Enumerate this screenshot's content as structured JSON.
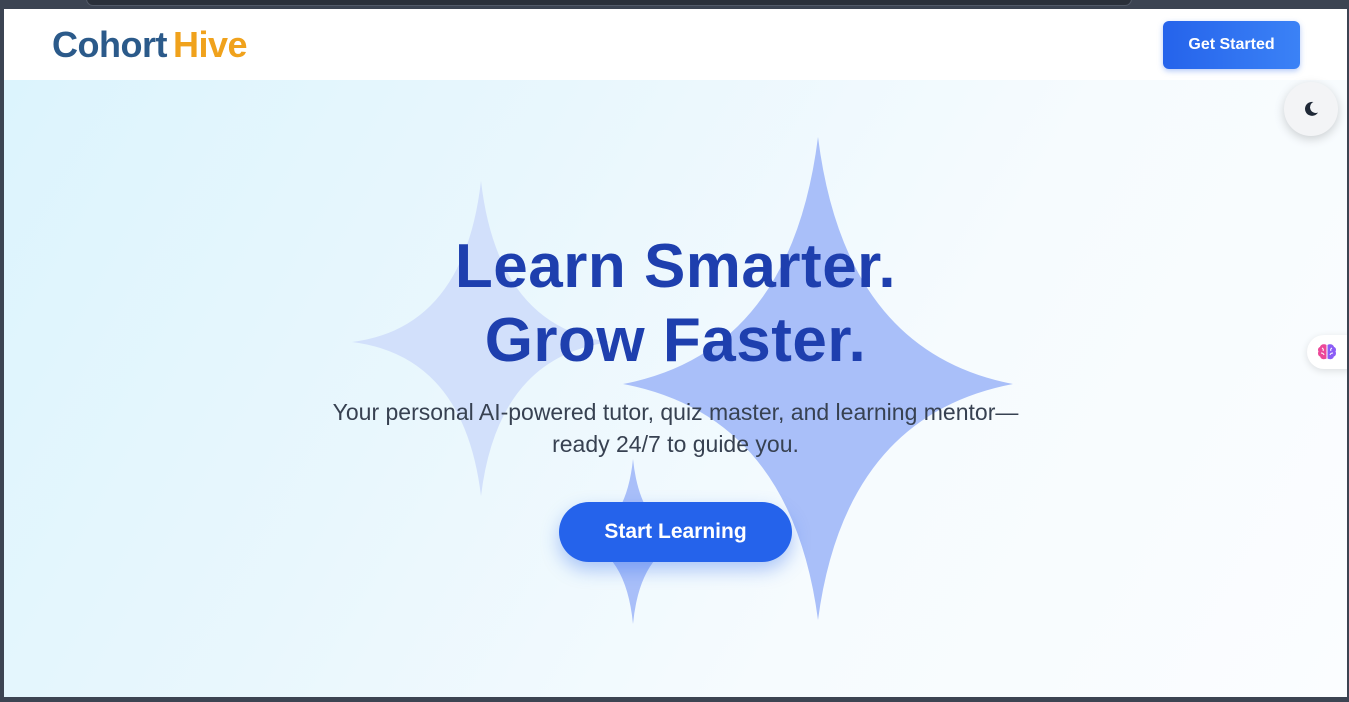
{
  "header": {
    "logo_part1": "Cohort",
    "logo_part2": "Hive",
    "cta_label": "Get Started"
  },
  "hero": {
    "title_line1": "Learn Smarter.",
    "title_line2": "Grow Faster.",
    "subtitle_line1": "Your personal AI-powered tutor, quiz master, and learning mentor—",
    "subtitle_line2": "ready 24/7 to guide you.",
    "cta_label": "Start Learning"
  },
  "widgets": {
    "theme_toggle_icon": "moon-icon",
    "assistant_icon": "brain-icon"
  },
  "colors": {
    "brand_blue": "#2b5a8a",
    "brand_orange": "#f0a21c",
    "primary": "#2563eb",
    "title": "#1e3fae",
    "sparkle_light": "#d2e0fb",
    "sparkle_dark": "#a9bff9"
  }
}
